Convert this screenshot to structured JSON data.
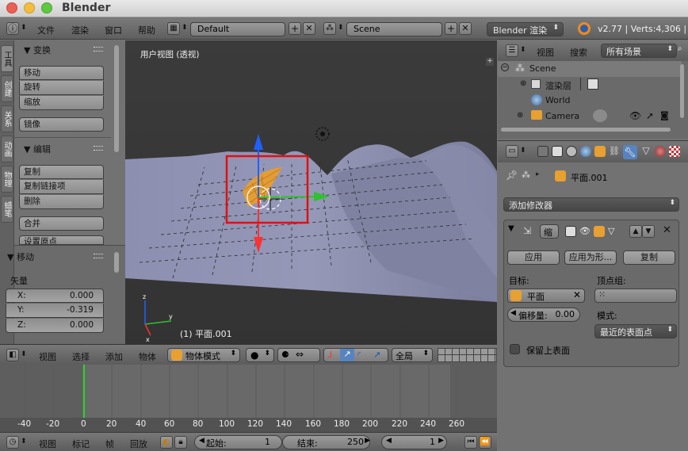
{
  "window": {
    "title": "Blender"
  },
  "info_header": {
    "menus": [
      "文件",
      "渲染",
      "窗口",
      "帮助"
    ],
    "layout": "Default",
    "scene": "Scene",
    "engine": "Blender 渲染",
    "stats": "v2.77 | Verts:4,306 |"
  },
  "toolshelf": {
    "tabs": [
      "工具",
      "创建",
      "关系",
      "动画",
      "物理",
      "蜡笔"
    ],
    "transform": {
      "title": "▼ 变换",
      "buttons": [
        "移动",
        "旋转",
        "缩放"
      ],
      "mirror": "镜像"
    },
    "edit": {
      "title": "▼ 编辑",
      "buttons": [
        "复制",
        "复制链接项",
        "删除"
      ],
      "join": "合并",
      "set_origin": "设置原点"
    }
  },
  "operator_panel": {
    "title": "▼ 移动",
    "vector_label": "矢量",
    "fields": [
      {
        "label": "X:",
        "value": "0.000"
      },
      {
        "label": "Y:",
        "value": "-0.319"
      },
      {
        "label": "Z:",
        "value": "0.000"
      }
    ]
  },
  "viewport": {
    "view_label": "用户视图 (透视)",
    "object_label": "(1) 平面.001"
  },
  "view3d_header": {
    "menus": [
      "视图",
      "选择",
      "添加",
      "物体"
    ],
    "mode": "物体模式",
    "orientation": "全局"
  },
  "timeline": {
    "ruler": [
      "-40",
      "-20",
      "0",
      "20",
      "40",
      "60",
      "80",
      "100",
      "120",
      "140",
      "160",
      "180",
      "200",
      "220",
      "240",
      "260"
    ],
    "menus": [
      "视图",
      "标记",
      "帧",
      "回放"
    ],
    "start_label": "起始:",
    "start_value": "1",
    "end_label": "结束:",
    "end_value": "250",
    "current_frame": "1"
  },
  "outliner": {
    "menus": [
      "视图",
      "搜索"
    ],
    "filter": "所有场景",
    "items": [
      {
        "label": "Scene",
        "indent": 0
      },
      {
        "label": "渲染层",
        "indent": 1
      },
      {
        "label": "World",
        "indent": 1
      },
      {
        "label": "Camera",
        "indent": 1
      }
    ]
  },
  "properties": {
    "breadcrumb": "平面.001",
    "add_modifier": "添加修改器",
    "modifier_name": "缩",
    "buttons": {
      "apply": "应用",
      "apply_as": "应用为形...",
      "copy": "复制"
    },
    "target_label": "目标:",
    "target_value": "平面",
    "vertex_group_label": "顶点组:",
    "offset_label": "偏移量:",
    "offset_value": "0.00",
    "mode_label": "模式:",
    "mode_value": "最近的表面点",
    "keep_above_label": "保留上表面"
  },
  "colors": {
    "selection_box": "#e01010",
    "axis_x": "#ff3030",
    "axis_y": "#30c030",
    "axis_z": "#2060ff",
    "timeline_cursor": "#2fd02f",
    "selected_object": "#f0a020"
  }
}
